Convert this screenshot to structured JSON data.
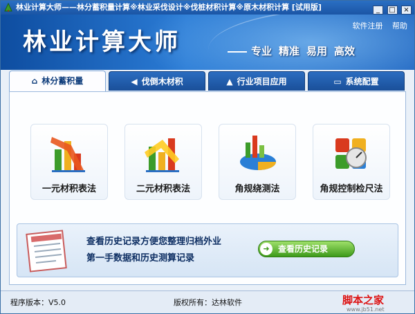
{
  "window": {
    "title": "林业计算大师——林分蓄积量计算※林业采伐设计※伐桩材积计算※原木材积计算 [试用版]",
    "controls": [
      "_",
      "□",
      "×"
    ]
  },
  "header": {
    "app_title": "林业计算大师",
    "slogan": [
      "专业",
      "精准",
      "易用",
      "高效"
    ],
    "menu": {
      "register": "软件注册",
      "help": "帮助"
    }
  },
  "tabs": [
    {
      "label": "林分蓄积量",
      "icon": "home-icon",
      "active": true
    },
    {
      "label": "伐倒木材积",
      "icon": "arrow-left-icon",
      "active": false
    },
    {
      "label": "行业项目应用",
      "icon": "arrow-up-icon",
      "active": false
    },
    {
      "label": "系统配置",
      "icon": "monitor-icon",
      "active": false
    }
  ],
  "features": [
    {
      "label": "一元材积表法",
      "icon": "bar-chart-icon"
    },
    {
      "label": "二元材积表法",
      "icon": "bar-chart-icon"
    },
    {
      "label": "角规绕测法",
      "icon": "pie-chart-icon"
    },
    {
      "label": "角规控制检尺法",
      "icon": "gauge-icon"
    }
  ],
  "history": {
    "line1": "查看历史记录方便您整理归档外业",
    "line2": "第一手数据和历史测算记录",
    "button": "查看历史记录"
  },
  "status": {
    "version": "程序版本：V5.0",
    "copyright": "版权所有：达林软件"
  },
  "watermark": {
    "brand": "脚本之家",
    "url": "www.jb51.net"
  },
  "colors": {
    "header_blue": "#1b62bf",
    "tab_blue": "#2b6dc0",
    "button_green": "#3d9a1a",
    "watermark_red": "#dd1111"
  }
}
